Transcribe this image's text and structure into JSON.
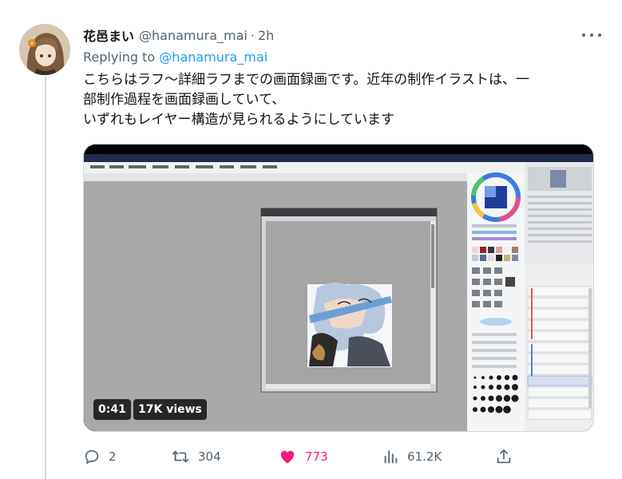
{
  "tweet": {
    "display_name": "花邑まい",
    "handle": "@hanamura_mai",
    "separator": "·",
    "time": "2h",
    "replying_prefix": "Replying to",
    "replying_handle": "@hanamura_mai",
    "text_lines": [
      "こちらはラフ～詳細ラフまでの画面録画です。近年の制作イラストは、一",
      "部制作過程を画面録画していて、",
      "いずれもレイヤー構造が見られるようにしています"
    ]
  },
  "video": {
    "duration": "0:41",
    "views": "17K views"
  },
  "actions": {
    "replies": "2",
    "retweets": "304",
    "likes": "773",
    "views": "61.2K"
  },
  "colors": {
    "accent": "#1d9bf0",
    "like": "#f91880",
    "muted": "#536471",
    "text": "#0f1419"
  },
  "icons": {
    "more": "more-icon",
    "reply": "reply-icon",
    "retweet": "retweet-icon",
    "like": "heart-icon",
    "analytics": "analytics-icon",
    "share": "share-icon"
  }
}
